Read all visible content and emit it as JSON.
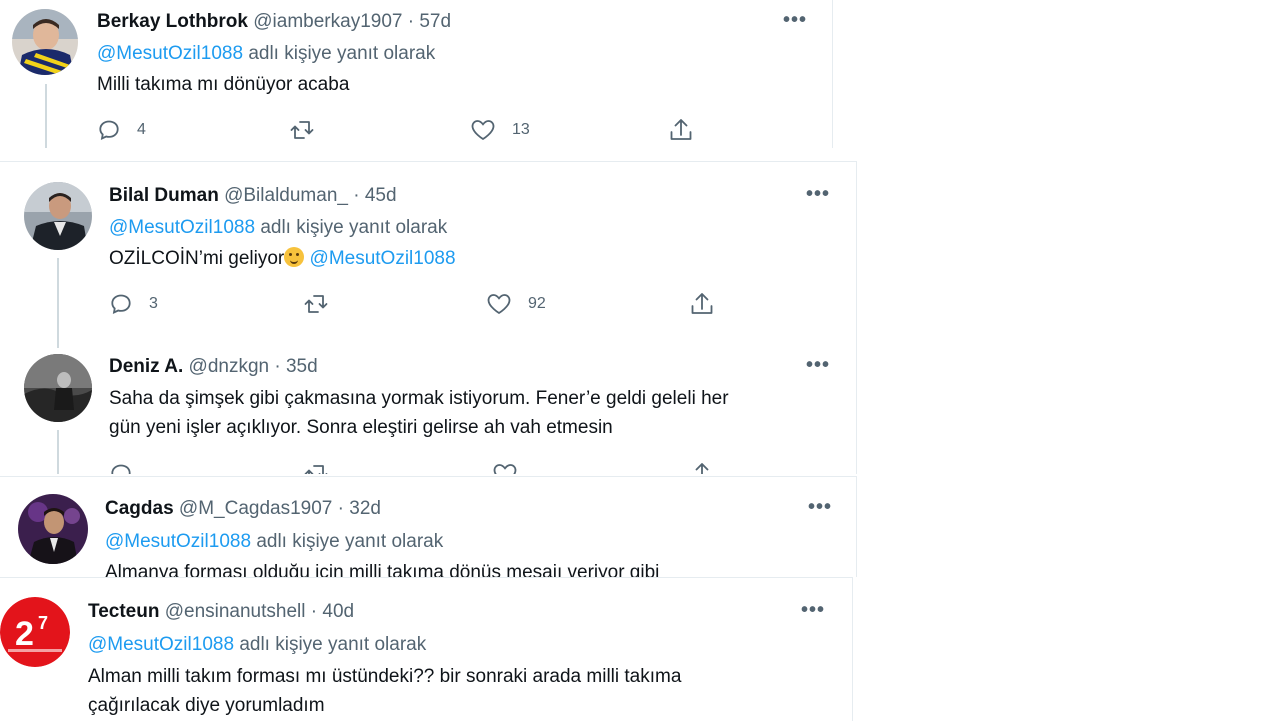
{
  "reply_prefix": "adlı kişiye yanıt olarak",
  "colors": {
    "link": "#1d9bf0",
    "muted": "#536471",
    "text": "#0f1419",
    "divider": "#e6ecf0"
  },
  "tweets": [
    {
      "name": "Berkay Lothbrok",
      "handle": "@iamberkay1907",
      "time": "57d",
      "reply_to": "@MesutOzil1088",
      "text": "Milli takıma mı dönüyor acaba",
      "replies": "4",
      "likes": "13",
      "avatar_icon": "fenerbahce-fan-avatar"
    },
    {
      "name": "Bilal Duman",
      "handle": "@Bilalduman_",
      "time": "45d",
      "reply_to": "@MesutOzil1088",
      "text": "OZİLCOİN’mi geliyor",
      "emoji": "thinking-face-icon",
      "text_mention": "@MesutOzil1088",
      "replies": "3",
      "likes": "92",
      "avatar_icon": "man-in-suit-avatar"
    },
    {
      "name": "Deniz A.",
      "handle": "@dnzkgn",
      "time": "35d",
      "text_line1": "Saha da şimşek gibi çakmasına yormak istiyorum. Fener’e geldi geleli her",
      "text_line2": "gün yeni işler açıklıyor. Sonra eleştiri gelirse ah vah etmesin",
      "avatar_icon": "person-bw-avatar"
    },
    {
      "name": "Cagdas",
      "handle": "@M_Cagdas1907",
      "time": "32d",
      "reply_to": "@MesutOzil1088",
      "text": "Almanya forması olduğu için milli takıma dönüş mesajı veriyor gibi",
      "avatar_icon": "man-purple-avatar"
    },
    {
      "name": "Tecteun",
      "handle": "@ensinanutshell",
      "time": "40d",
      "reply_to": "@MesutOzil1088",
      "text_line1": "Alman milli takım forması mı üstündeki?? bir sonraki arada milli takıma",
      "text_line2": "çağırılacak diye yorumladım",
      "avatar_icon": "red-27-logo-avatar"
    }
  ]
}
